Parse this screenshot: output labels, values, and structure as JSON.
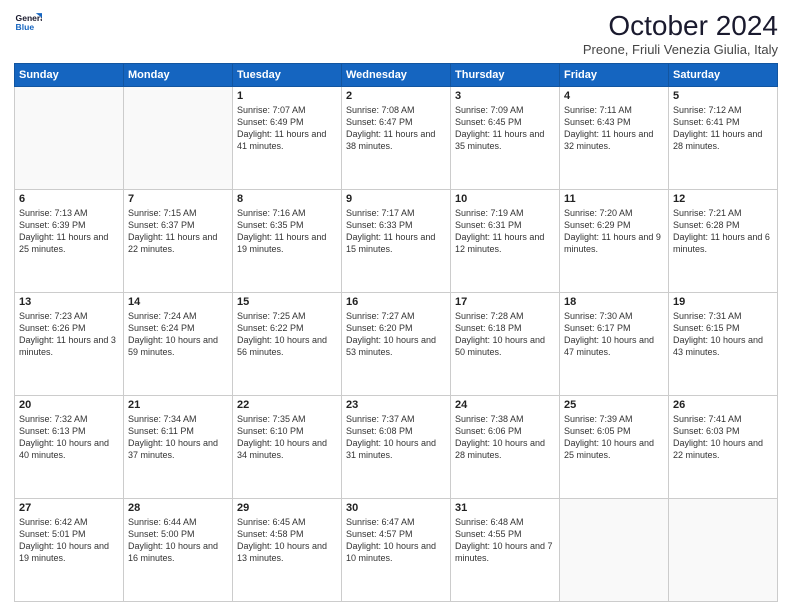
{
  "header": {
    "logo_general": "General",
    "logo_blue": "Blue",
    "month_title": "October 2024",
    "location": "Preone, Friuli Venezia Giulia, Italy"
  },
  "weekdays": [
    "Sunday",
    "Monday",
    "Tuesday",
    "Wednesday",
    "Thursday",
    "Friday",
    "Saturday"
  ],
  "weeks": [
    [
      {
        "day": "",
        "info": ""
      },
      {
        "day": "",
        "info": ""
      },
      {
        "day": "1",
        "info": "Sunrise: 7:07 AM\nSunset: 6:49 PM\nDaylight: 11 hours and 41 minutes."
      },
      {
        "day": "2",
        "info": "Sunrise: 7:08 AM\nSunset: 6:47 PM\nDaylight: 11 hours and 38 minutes."
      },
      {
        "day": "3",
        "info": "Sunrise: 7:09 AM\nSunset: 6:45 PM\nDaylight: 11 hours and 35 minutes."
      },
      {
        "day": "4",
        "info": "Sunrise: 7:11 AM\nSunset: 6:43 PM\nDaylight: 11 hours and 32 minutes."
      },
      {
        "day": "5",
        "info": "Sunrise: 7:12 AM\nSunset: 6:41 PM\nDaylight: 11 hours and 28 minutes."
      }
    ],
    [
      {
        "day": "6",
        "info": "Sunrise: 7:13 AM\nSunset: 6:39 PM\nDaylight: 11 hours and 25 minutes."
      },
      {
        "day": "7",
        "info": "Sunrise: 7:15 AM\nSunset: 6:37 PM\nDaylight: 11 hours and 22 minutes."
      },
      {
        "day": "8",
        "info": "Sunrise: 7:16 AM\nSunset: 6:35 PM\nDaylight: 11 hours and 19 minutes."
      },
      {
        "day": "9",
        "info": "Sunrise: 7:17 AM\nSunset: 6:33 PM\nDaylight: 11 hours and 15 minutes."
      },
      {
        "day": "10",
        "info": "Sunrise: 7:19 AM\nSunset: 6:31 PM\nDaylight: 11 hours and 12 minutes."
      },
      {
        "day": "11",
        "info": "Sunrise: 7:20 AM\nSunset: 6:29 PM\nDaylight: 11 hours and 9 minutes."
      },
      {
        "day": "12",
        "info": "Sunrise: 7:21 AM\nSunset: 6:28 PM\nDaylight: 11 hours and 6 minutes."
      }
    ],
    [
      {
        "day": "13",
        "info": "Sunrise: 7:23 AM\nSunset: 6:26 PM\nDaylight: 11 hours and 3 minutes."
      },
      {
        "day": "14",
        "info": "Sunrise: 7:24 AM\nSunset: 6:24 PM\nDaylight: 10 hours and 59 minutes."
      },
      {
        "day": "15",
        "info": "Sunrise: 7:25 AM\nSunset: 6:22 PM\nDaylight: 10 hours and 56 minutes."
      },
      {
        "day": "16",
        "info": "Sunrise: 7:27 AM\nSunset: 6:20 PM\nDaylight: 10 hours and 53 minutes."
      },
      {
        "day": "17",
        "info": "Sunrise: 7:28 AM\nSunset: 6:18 PM\nDaylight: 10 hours and 50 minutes."
      },
      {
        "day": "18",
        "info": "Sunrise: 7:30 AM\nSunset: 6:17 PM\nDaylight: 10 hours and 47 minutes."
      },
      {
        "day": "19",
        "info": "Sunrise: 7:31 AM\nSunset: 6:15 PM\nDaylight: 10 hours and 43 minutes."
      }
    ],
    [
      {
        "day": "20",
        "info": "Sunrise: 7:32 AM\nSunset: 6:13 PM\nDaylight: 10 hours and 40 minutes."
      },
      {
        "day": "21",
        "info": "Sunrise: 7:34 AM\nSunset: 6:11 PM\nDaylight: 10 hours and 37 minutes."
      },
      {
        "day": "22",
        "info": "Sunrise: 7:35 AM\nSunset: 6:10 PM\nDaylight: 10 hours and 34 minutes."
      },
      {
        "day": "23",
        "info": "Sunrise: 7:37 AM\nSunset: 6:08 PM\nDaylight: 10 hours and 31 minutes."
      },
      {
        "day": "24",
        "info": "Sunrise: 7:38 AM\nSunset: 6:06 PM\nDaylight: 10 hours and 28 minutes."
      },
      {
        "day": "25",
        "info": "Sunrise: 7:39 AM\nSunset: 6:05 PM\nDaylight: 10 hours and 25 minutes."
      },
      {
        "day": "26",
        "info": "Sunrise: 7:41 AM\nSunset: 6:03 PM\nDaylight: 10 hours and 22 minutes."
      }
    ],
    [
      {
        "day": "27",
        "info": "Sunrise: 6:42 AM\nSunset: 5:01 PM\nDaylight: 10 hours and 19 minutes."
      },
      {
        "day": "28",
        "info": "Sunrise: 6:44 AM\nSunset: 5:00 PM\nDaylight: 10 hours and 16 minutes."
      },
      {
        "day": "29",
        "info": "Sunrise: 6:45 AM\nSunset: 4:58 PM\nDaylight: 10 hours and 13 minutes."
      },
      {
        "day": "30",
        "info": "Sunrise: 6:47 AM\nSunset: 4:57 PM\nDaylight: 10 hours and 10 minutes."
      },
      {
        "day": "31",
        "info": "Sunrise: 6:48 AM\nSunset: 4:55 PM\nDaylight: 10 hours and 7 minutes."
      },
      {
        "day": "",
        "info": ""
      },
      {
        "day": "",
        "info": ""
      }
    ]
  ]
}
